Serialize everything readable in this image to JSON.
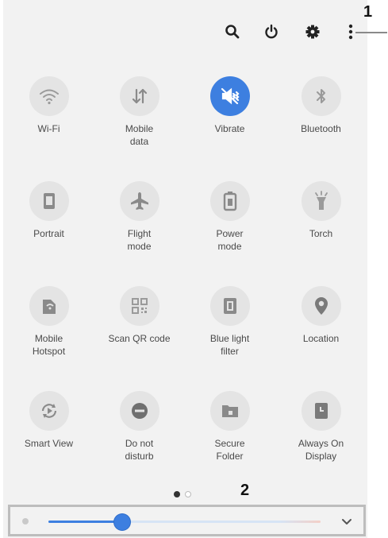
{
  "callouts": [
    "1",
    "2"
  ],
  "top_icons": [
    "search-icon",
    "power-icon",
    "gear-icon",
    "more-vertical-icon"
  ],
  "tiles": [
    {
      "label": "Wi-Fi",
      "icon": "wifi-icon",
      "active": false
    },
    {
      "label": "Mobile\ndata",
      "icon": "mobile-data-icon",
      "active": false
    },
    {
      "label": "Vibrate",
      "icon": "vibrate-icon",
      "active": true
    },
    {
      "label": "Bluetooth",
      "icon": "bluetooth-icon",
      "active": false
    },
    {
      "label": "Portrait",
      "icon": "portrait-icon",
      "active": false
    },
    {
      "label": "Flight\nmode",
      "icon": "airplane-icon",
      "active": false
    },
    {
      "label": "Power\nmode",
      "icon": "battery-icon",
      "active": false
    },
    {
      "label": "Torch",
      "icon": "torch-icon",
      "active": false
    },
    {
      "label": "Mobile\nHotspot",
      "icon": "hotspot-icon",
      "active": false
    },
    {
      "label": "Scan QR code",
      "icon": "qr-code-icon",
      "active": false
    },
    {
      "label": "Blue light\nfilter",
      "icon": "blue-light-icon",
      "active": false
    },
    {
      "label": "Location",
      "icon": "location-pin-icon",
      "active": false
    },
    {
      "label": "Smart View",
      "icon": "smart-view-icon",
      "active": false
    },
    {
      "label": "Do not\ndisturb",
      "icon": "do-not-disturb-icon",
      "active": false
    },
    {
      "label": "Secure\nFolder",
      "icon": "secure-folder-icon",
      "active": false
    },
    {
      "label": "Always On\nDisplay",
      "icon": "always-on-display-icon",
      "active": false
    }
  ],
  "pager": {
    "pages": 2,
    "current": 1
  },
  "brightness": {
    "level": 0.27,
    "icon": "brightness-icon",
    "expand_icon": "chevron-down-icon"
  },
  "colors": {
    "accent": "#3d7fe0",
    "panel": "#f2f2f2",
    "tile": "#e4e4e4"
  }
}
